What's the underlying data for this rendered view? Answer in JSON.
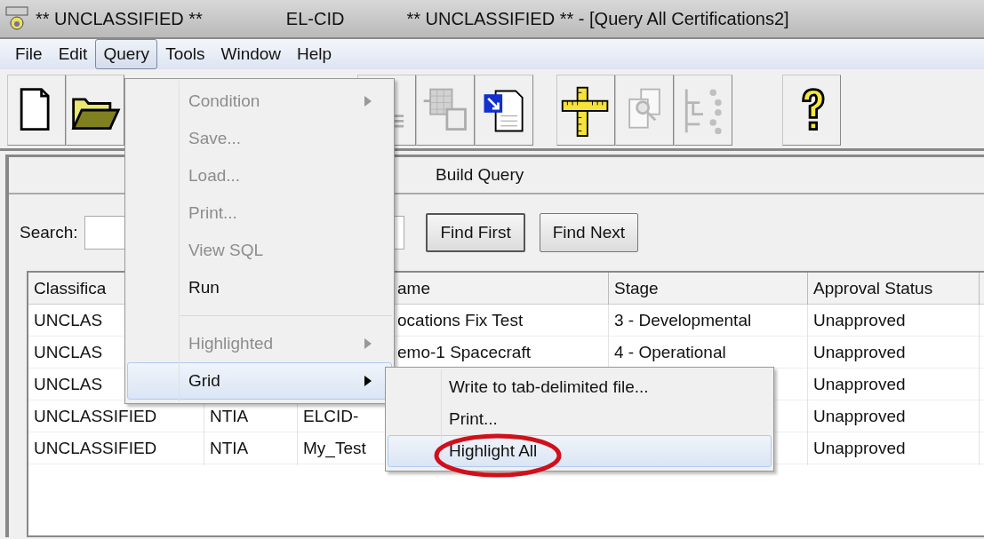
{
  "window": {
    "title_parts": [
      "** UNCLASSIFIED **",
      "EL-CID",
      "** UNCLASSIFIED ** - [Query All Certifications2]"
    ]
  },
  "menubar": [
    {
      "label": "File",
      "selected": false
    },
    {
      "label": "Edit",
      "selected": false
    },
    {
      "label": "Query",
      "selected": true
    },
    {
      "label": "Tools",
      "selected": false
    },
    {
      "label": "Window",
      "selected": false
    },
    {
      "label": "Help",
      "selected": false
    }
  ],
  "toolbar": [
    {
      "kind": "new-document",
      "disabled": false
    },
    {
      "kind": "open-folder",
      "disabled": false
    },
    {
      "kind": "align",
      "disabled": true
    },
    {
      "kind": "grid-copy",
      "disabled": true
    },
    {
      "kind": "document-link",
      "disabled": false
    },
    {
      "kind": "ruler",
      "disabled": false
    },
    {
      "kind": "find-document",
      "disabled": true
    },
    {
      "kind": "tree",
      "disabled": true
    },
    {
      "kind": "help",
      "disabled": false
    }
  ],
  "child_window": {
    "title": "Build Query",
    "search_label": "Search:",
    "buttons": [
      "Find First",
      "Find Next"
    ],
    "table": {
      "columns": [
        "Classifica",
        null,
        "ame",
        "Stage",
        "Approval Status"
      ],
      "rows": [
        [
          "UNCLAS",
          null,
          "ocations Fix Test",
          "3 - Developmental",
          "Unapproved"
        ],
        [
          "UNCLAS",
          null,
          "emo-1 Spacecraft",
          "4 - Operational",
          "Unapproved"
        ],
        [
          "UNCLAS",
          null,
          null,
          null,
          "Unapproved"
        ],
        [
          "UNCLASSIFIED",
          "NTIA",
          "ELCID-",
          null,
          "Unapproved"
        ],
        [
          "UNCLASSIFIED",
          "NTIA",
          "My_Test",
          null,
          "Unapproved"
        ]
      ]
    }
  },
  "query_menu": [
    {
      "label": "Condition",
      "disabled": true,
      "submenu": true,
      "selected": false
    },
    {
      "label": "Save...",
      "disabled": true,
      "submenu": false,
      "selected": false
    },
    {
      "label": "Load...",
      "disabled": true,
      "submenu": false,
      "selected": false
    },
    {
      "label": "Print...",
      "disabled": true,
      "submenu": false,
      "selected": false
    },
    {
      "label": "View SQL",
      "disabled": true,
      "submenu": false,
      "selected": false
    },
    {
      "label": "Run",
      "disabled": false,
      "submenu": false,
      "selected": false
    },
    {
      "kind": "separator"
    },
    {
      "label": "Highlighted",
      "disabled": true,
      "submenu": true,
      "selected": false
    },
    {
      "label": "Grid",
      "disabled": false,
      "submenu": true,
      "selected": true
    }
  ],
  "grid_submenu": [
    {
      "label": "Write to tab-delimited file...",
      "selected": false,
      "circled": false
    },
    {
      "label": "Print...",
      "selected": false,
      "circled": false
    },
    {
      "label": "Highlight All",
      "selected": true,
      "circled": true
    }
  ]
}
